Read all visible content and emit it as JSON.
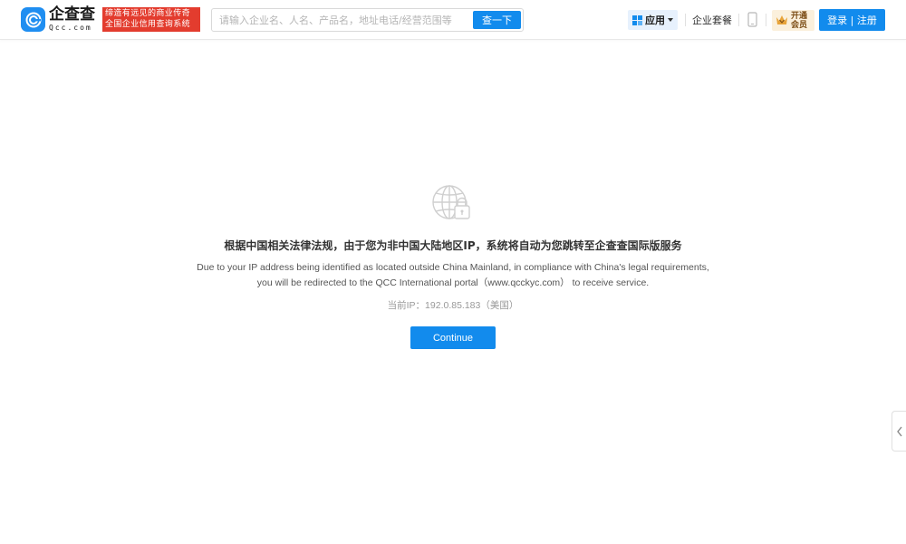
{
  "header": {
    "logo": {
      "cn": "企查查",
      "en": "Qcc.com"
    },
    "slogan": {
      "line1": "缔造有远见的商业传奇",
      "line2": "全国企业信用查询系统"
    },
    "search": {
      "placeholder": "请输入企业名、人名、产品名，地址电话/经营范围等",
      "button_label": "查一下"
    },
    "apps_label": "应用",
    "package_label": "企业套餐",
    "vip": {
      "line1": "开通",
      "line2": "会员"
    },
    "login_label": "登录 | 注册"
  },
  "notice": {
    "title_cn": "根据中国相关法律法规，由于您为非中国大陆地区IP，系统将自动为您跳转至企查查国际版服务",
    "desc_line1": "Due to your IP address being identified as located outside China Mainland, in compliance with China's legal requirements,",
    "desc_line2": "you will be redirected to the QCC International portal（www.qcckyc.com） to receive service.",
    "ip_label": "当前IP：192.0.85.183（美国）",
    "continue_label": "Continue"
  },
  "colors": {
    "brand_blue": "#128bed",
    "slogan_red": "#e33c2e",
    "vip_bg": "#fbf0dc"
  }
}
